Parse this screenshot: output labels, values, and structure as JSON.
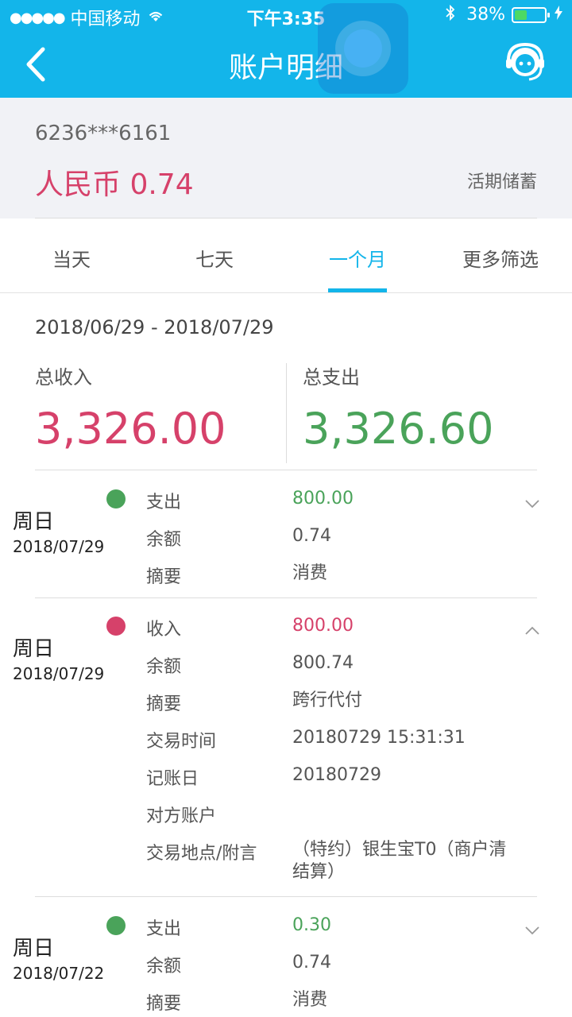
{
  "status": {
    "carrier": "中国移动",
    "time": "下午3:35",
    "battery": "38%"
  },
  "nav": {
    "title": "账户明细"
  },
  "account": {
    "number": "6236***6161",
    "balance": "人民币 0.74",
    "type": "活期储蓄"
  },
  "tabs": [
    {
      "label": "当天"
    },
    {
      "label": "七天"
    },
    {
      "label": "一个月"
    },
    {
      "label": "更多筛选"
    }
  ],
  "summary": {
    "range": "2018/06/29 - 2018/07/29",
    "income_label": "总收入",
    "income_value": "3,326.00",
    "expense_label": "总支出",
    "expense_value": "3,326.60"
  },
  "transactions": [
    {
      "weekday": "周日",
      "date": "2018/07/29",
      "rows": [
        {
          "k": "支出",
          "v": "800.00"
        },
        {
          "k": "余额",
          "v": "0.74"
        },
        {
          "k": "摘要",
          "v": "消费"
        }
      ]
    },
    {
      "weekday": "周日",
      "date": "2018/07/29",
      "rows": [
        {
          "k": "收入",
          "v": "800.00"
        },
        {
          "k": "余额",
          "v": "800.74"
        },
        {
          "k": "摘要",
          "v": "跨行代付"
        },
        {
          "k": "交易时间",
          "v": "20180729 15:31:31"
        },
        {
          "k": "记账日",
          "v": "20180729"
        },
        {
          "k": "对方账户",
          "v": ""
        },
        {
          "k": "交易地点/附言",
          "v": "（特约）银生宝T0（商户清结算）"
        }
      ]
    },
    {
      "weekday": "周日",
      "date": "2018/07/22",
      "rows": [
        {
          "k": "支出",
          "v": "0.30"
        },
        {
          "k": "余额",
          "v": "0.74"
        },
        {
          "k": "摘要",
          "v": "消费"
        }
      ]
    }
  ],
  "colors": {
    "brand": "#13b5ea",
    "income": "#d6416a",
    "expense": "#4aa35a"
  }
}
